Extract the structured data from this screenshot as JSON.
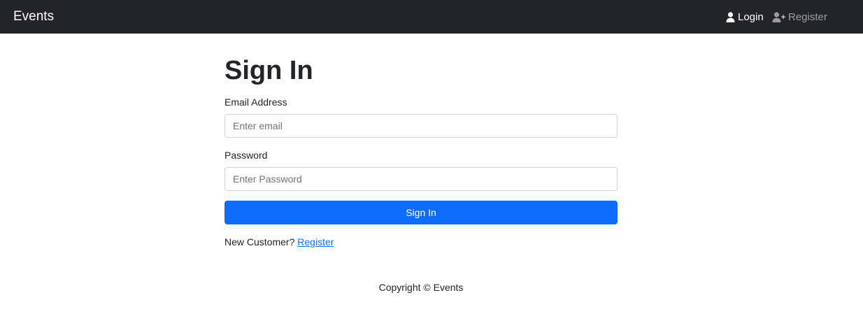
{
  "navbar": {
    "brand": "Events",
    "login_label": "Login",
    "login_icon": "user-icon",
    "register_label": "Register",
    "register_icon": "user-plus-icon"
  },
  "form": {
    "title": "Sign In",
    "email_label": "Email Address",
    "email_placeholder": "Enter email",
    "email_value": "",
    "password_label": "Password",
    "password_placeholder": "Enter Password",
    "password_value": "",
    "submit_label": "Sign In",
    "new_customer_text": "New Customer?",
    "register_link": "Register"
  },
  "footer": {
    "copyright": "Copyright © Events"
  },
  "colors": {
    "navbar_bg": "#212529",
    "primary": "#0d6efd",
    "link": "#0d6efd",
    "muted_nav": "rgba(255,255,255,0.55)"
  }
}
